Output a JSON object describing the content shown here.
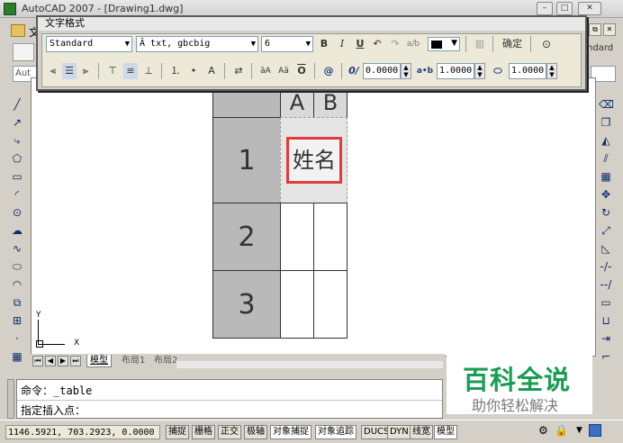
{
  "app": {
    "title": "AutoCAD 2007 - [Drawing1.dwg]"
  },
  "menubar": {
    "first_menu": "文"
  },
  "dialog": {
    "title": "文字格式",
    "style_combo": "Standard",
    "font_combo": "txt, gbcbig",
    "height_combo": "6",
    "bold": "B",
    "italic": "I",
    "underline": "U",
    "ok_label": "确定",
    "oblique_value": "0.0000",
    "tracking_value": "1.0000",
    "width_value": "1.0000"
  },
  "drawing": {
    "table": {
      "col_headers": [
        "A",
        "B"
      ],
      "row_numbers": [
        "1",
        "2",
        "3"
      ],
      "edited_cell_text": "姓名"
    },
    "ucs": {
      "y_label": "Y",
      "x_label": "X"
    },
    "right_label": "ndard",
    "left_label": "Aut"
  },
  "tabs": {
    "model": "模型",
    "layout1": "布局1",
    "layout2": "布局2"
  },
  "command": {
    "line1_prefix": "命令：",
    "line1_value": "_table",
    "line2": "指定插入点："
  },
  "status": {
    "coords": "1146.5921, 703.2923, 0.0000",
    "buttons": [
      "捕捉",
      "栅格",
      "正交",
      "极轴",
      "对象捕捉",
      "对象追踪",
      "DUCS",
      "DYN",
      "线宽",
      "模型"
    ]
  },
  "watermark": {
    "main": "百科全说",
    "sub": "助你轻松解决"
  },
  "colors": {
    "highlight_box": "#e33a3a",
    "watermark_green": "#1b9c55",
    "table_gray": "#b9b9b9"
  }
}
